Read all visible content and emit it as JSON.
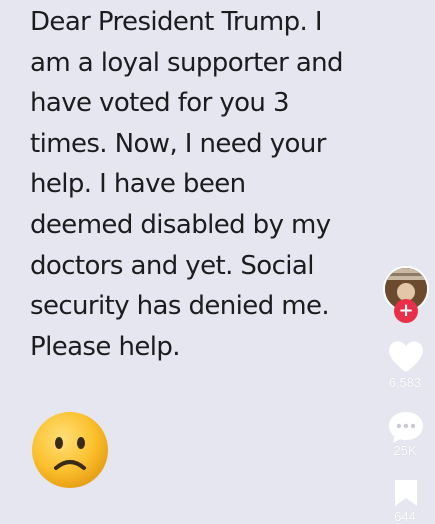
{
  "post": {
    "lines": [
      "Dear President Trump. I",
      "am a loyal supporter and",
      "have voted for you 3",
      "times. Now, I need your",
      "help. I have been",
      "deemed disabled by my",
      "doctors and yet. Social",
      "security has denied me.",
      "Please help."
    ]
  },
  "emoji": {
    "icon": "frowning-face-emoji"
  },
  "sidebar": {
    "follow_label": "+",
    "like_count": "6,583",
    "comment_count": "25K",
    "save_count": "644"
  },
  "colors": {
    "background": "#e5e6ef",
    "text": "#1c1c1e",
    "follow_red": "#ea2f4a",
    "icon_white": "#ffffff"
  }
}
